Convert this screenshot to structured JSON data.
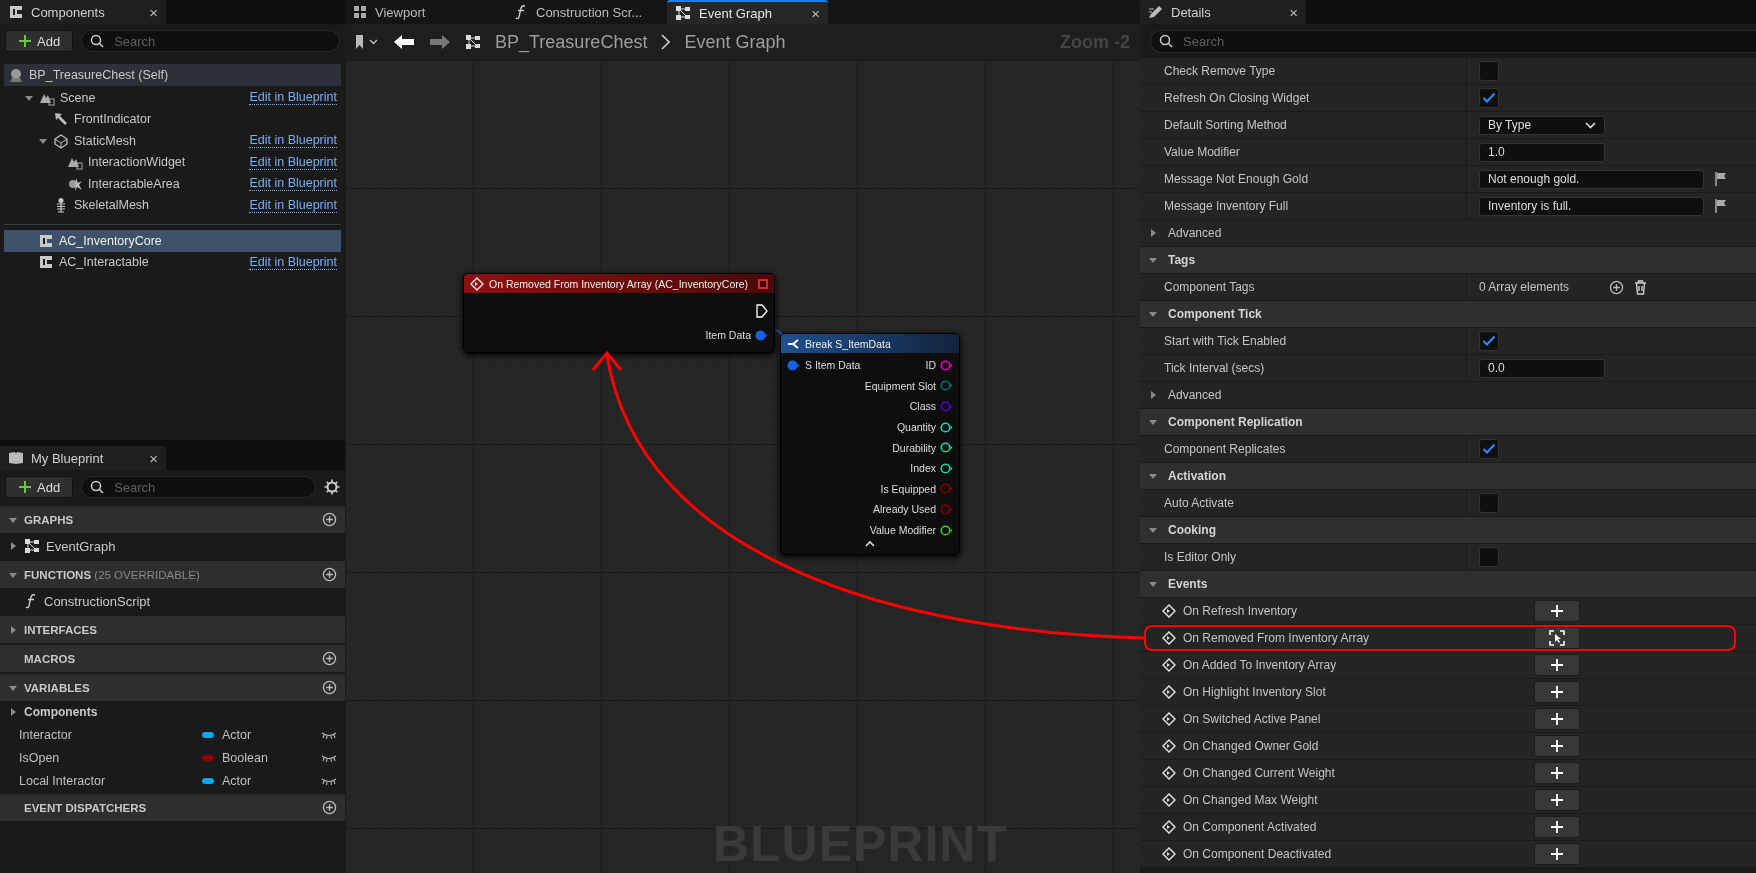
{
  "components_panel": {
    "tab": {
      "title": "Components",
      "close": "×"
    },
    "add_button": "Add",
    "search": {
      "placeholder": "Search"
    },
    "root": {
      "label": "BP_TreasureChest (Self)"
    },
    "tree": [
      {
        "label": "Scene",
        "kind": "scene",
        "link": "Edit in Blueprint",
        "expanded": true,
        "selected": false,
        "children": [
          {
            "label": "FrontIndicator",
            "kind": "arrow",
            "selected": false
          },
          {
            "label": "StaticMesh",
            "kind": "mesh",
            "link": "Edit in Blueprint",
            "expanded": true,
            "selected": false,
            "children": [
              {
                "label": "InteractionWidget",
                "kind": "widget",
                "link": "Edit in Blueprint",
                "selected": false
              },
              {
                "label": "InteractableArea",
                "kind": "collision",
                "link": "Edit in Blueprint",
                "selected": false
              }
            ]
          },
          {
            "label": "SkeletalMesh",
            "kind": "skeletal",
            "link": "Edit in Blueprint",
            "selected": false
          }
        ]
      }
    ],
    "components": [
      {
        "label": "AC_InventoryCore",
        "selected": true
      },
      {
        "label": "AC_Interactable",
        "link": "Edit in Blueprint",
        "selected": false
      }
    ]
  },
  "my_blueprint": {
    "tab": {
      "title": "My Blueprint",
      "close": "×"
    },
    "add_button": "Add",
    "search": {
      "placeholder": "Search"
    },
    "sections": [
      {
        "title": "GRAPHS",
        "expanded": true,
        "addable": true,
        "items": [
          {
            "label": "EventGraph",
            "kind": "graph",
            "expanded": false
          }
        ]
      },
      {
        "title": "FUNCTIONS",
        "note": "(25 OVERRIDABLE)",
        "expanded": true,
        "addable": true,
        "items": [
          {
            "label": "ConstructionScript",
            "kind": "function"
          }
        ]
      },
      {
        "title": "INTERFACES",
        "expanded": false,
        "addable": false
      },
      {
        "title": "MACROS",
        "addable": true
      },
      {
        "title": "VARIABLES",
        "expanded": true,
        "addable": true,
        "categories": [
          {
            "label": "Components",
            "expanded": false
          }
        ],
        "variables": [
          {
            "name": "Interactor",
            "type": "Actor",
            "color": "#00a8f0"
          },
          {
            "name": "IsOpen",
            "type": "Boolean",
            "color": "#930000"
          },
          {
            "name": "Local Interactor",
            "type": "Actor",
            "color": "#00a8f0"
          }
        ]
      },
      {
        "title": "EVENT DISPATCHERS",
        "addable": true
      }
    ]
  },
  "editor_tabs": [
    {
      "label": "Viewport",
      "kind": "viewport",
      "selected": false
    },
    {
      "label": "Construction Scr...",
      "kind": "function",
      "selected": false
    },
    {
      "label": "Event Graph",
      "kind": "graph",
      "selected": true,
      "close": "×"
    }
  ],
  "toolbar": {
    "breadcrumb": [
      "BP_TreasureChest",
      "Event Graph"
    ],
    "zoom": "Zoom -2"
  },
  "graph": {
    "nodes": [
      {
        "kind": "event",
        "title": "On Removed From Inventory Array (AC_InventoryCore)",
        "outputs": [
          {
            "kind": "exec",
            "connected": false
          },
          {
            "kind": "data",
            "label": "Item Data",
            "color": "#1560e0",
            "connected": true
          }
        ]
      },
      {
        "kind": "break",
        "title": "Break S_ItemData",
        "inputs": [
          {
            "kind": "data",
            "label": "S Item Data",
            "color": "#1560e0",
            "connected": true
          }
        ],
        "outputs": [
          {
            "kind": "data",
            "label": "ID",
            "color": "#f000c8",
            "connected": false
          },
          {
            "kind": "data",
            "label": "Equipment Slot",
            "color": "#0d6b6b",
            "connected": false
          },
          {
            "kind": "data",
            "label": "Class",
            "color": "#5a00d0",
            "connected": false
          },
          {
            "kind": "data",
            "label": "Quantity",
            "color": "#1ed6a4",
            "connected": false
          },
          {
            "kind": "data",
            "label": "Durability",
            "color": "#1ed6a4",
            "connected": false
          },
          {
            "kind": "data",
            "label": "Index",
            "color": "#1ed6a4",
            "connected": false
          },
          {
            "kind": "data",
            "label": "Is Equipped",
            "color": "#8a0000",
            "connected": false
          },
          {
            "kind": "data",
            "label": "Already Used",
            "color": "#8a0000",
            "connected": false
          },
          {
            "kind": "data",
            "label": "Value Modifier",
            "color": "#38d500",
            "connected": false
          }
        ]
      }
    ],
    "watermark": "BLUEPRINT"
  },
  "details": {
    "tab": {
      "title": "Details",
      "close": "×"
    },
    "search": {
      "placeholder": "Search"
    },
    "rows": [
      {
        "kind": "checkbox",
        "label": "Check Remove Type",
        "checked": false
      },
      {
        "kind": "checkbox",
        "label": "Refresh On Closing Widget",
        "checked": true
      },
      {
        "kind": "dropdown",
        "label": "Default Sorting Method",
        "value": "By Type"
      },
      {
        "kind": "number",
        "label": "Value Modifier",
        "value": "1.0"
      },
      {
        "kind": "text",
        "label": "Message Not Enough Gold",
        "value": "Not enough gold."
      },
      {
        "kind": "text",
        "label": "Message Inventory Full",
        "value": "Inventory is full."
      },
      {
        "kind": "group",
        "label": "Advanced",
        "expanded": false
      },
      {
        "kind": "section",
        "label": "Tags",
        "expanded": true
      },
      {
        "kind": "array",
        "label": "Component Tags",
        "value": "0 Array elements"
      },
      {
        "kind": "section",
        "label": "Component Tick",
        "expanded": true
      },
      {
        "kind": "checkbox",
        "label": "Start with Tick Enabled",
        "checked": true
      },
      {
        "kind": "number",
        "label": "Tick Interval (secs)",
        "value": "0.0"
      },
      {
        "kind": "group",
        "label": "Advanced",
        "expanded": false
      },
      {
        "kind": "section",
        "label": "Component Replication",
        "expanded": true
      },
      {
        "kind": "checkbox",
        "label": "Component Replicates",
        "checked": true
      },
      {
        "kind": "section",
        "label": "Activation",
        "expanded": true
      },
      {
        "kind": "checkbox",
        "label": "Auto Activate",
        "checked": false
      },
      {
        "kind": "section",
        "label": "Cooking",
        "expanded": true
      },
      {
        "kind": "checkbox",
        "label": "Is Editor Only",
        "checked": false
      },
      {
        "kind": "section",
        "label": "Events",
        "expanded": true
      },
      {
        "kind": "event",
        "label": "On Refresh Inventory",
        "bound": false,
        "highlighted": false
      },
      {
        "kind": "event",
        "label": "On Removed From Inventory Array",
        "bound": true,
        "highlighted": true
      },
      {
        "kind": "event",
        "label": "On Added To Inventory Array",
        "bound": false,
        "highlighted": false
      },
      {
        "kind": "event",
        "label": "On Highlight Inventory Slot",
        "bound": false,
        "highlighted": false
      },
      {
        "kind": "event",
        "label": "On Switched Active Panel",
        "bound": false,
        "highlighted": false
      },
      {
        "kind": "event",
        "label": "On Changed Owner Gold",
        "bound": false,
        "highlighted": false
      },
      {
        "kind": "event",
        "label": "On Changed Current Weight",
        "bound": false,
        "highlighted": false
      },
      {
        "kind": "event",
        "label": "On Changed Max Weight",
        "bound": false,
        "highlighted": false
      },
      {
        "kind": "event",
        "label": "On Component Activated",
        "bound": false,
        "highlighted": false
      },
      {
        "kind": "event",
        "label": "On Component Deactivated",
        "bound": false,
        "highlighted": false
      }
    ]
  }
}
